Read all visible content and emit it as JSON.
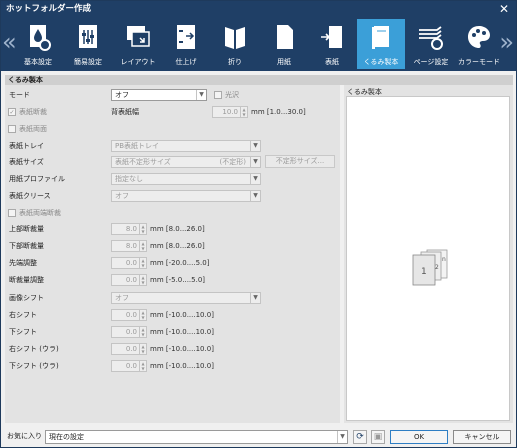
{
  "window": {
    "title": "ホットフォルダー作成"
  },
  "toolbar": {
    "tabs": [
      {
        "label": "基本設定",
        "icon": "drop-gear-icon"
      },
      {
        "label": "簡易設定",
        "icon": "sliders-doc-icon"
      },
      {
        "label": "レイアウト",
        "icon": "layout-icon"
      },
      {
        "label": "仕上げ",
        "icon": "staple-doc-icon"
      },
      {
        "label": "折り",
        "icon": "fold-icon"
      },
      {
        "label": "用紙",
        "icon": "paper-icon"
      },
      {
        "label": "表紙",
        "icon": "cover-icon"
      },
      {
        "label": "くるみ製本",
        "icon": "book-icon"
      },
      {
        "label": "ページ設定",
        "icon": "page-gear-icon"
      },
      {
        "label": "カラーモード",
        "icon": "palette-icon"
      }
    ],
    "active": "くるみ製本",
    "active_color": "#3b9fd8",
    "bar_color": "#1f3f66"
  },
  "section": {
    "title": "くるみ製本"
  },
  "form": {
    "mode": {
      "label": "モード",
      "value": "オフ",
      "gloss_label": "光沢"
    },
    "cover_trim": {
      "label": "表紙断裁",
      "checked": true,
      "spine_label": "背表紙幅",
      "spine_value": "10.0",
      "spine_unit": "mm [1.0...30.0]"
    },
    "cover_both_sides": {
      "label": "表紙両面"
    },
    "cover_tray": {
      "label": "表紙トレイ",
      "value": "PB表紙トレイ"
    },
    "cover_size": {
      "label": "表紙サイズ",
      "value": "表紙不定形サイズ",
      "value_note": "(不定形)",
      "button": "不定形サイズ..."
    },
    "paper_profile": {
      "label": "用紙プロファイル",
      "value": "指定なし"
    },
    "cover_crease": {
      "label": "表紙クリース",
      "value": "オフ"
    },
    "cover_both_trim": {
      "label": "表紙両端断裁"
    },
    "top_trim": {
      "label": "上部断裁量",
      "value": "8.0",
      "unit": "mm [8.0...26.0]"
    },
    "bottom_trim": {
      "label": "下部断裁量",
      "value": "8.0",
      "unit": "mm [8.0...26.0]"
    },
    "lead_adjust": {
      "label": "先端調整",
      "value": "0.0",
      "unit": "mm [-20.0....5.0]"
    },
    "trim_adjust": {
      "label": "断裁量調整",
      "value": "0.0",
      "unit": "mm [-5.0....5.0]"
    },
    "image_shift": {
      "label": "画像シフト",
      "value": "オフ"
    },
    "right_shift": {
      "label": "右シフト",
      "value": "0.0",
      "unit": "mm [-10.0....10.0]"
    },
    "down_shift": {
      "label": "下シフト",
      "value": "0.0",
      "unit": "mm [-10.0....10.0]"
    },
    "right_shift_back": {
      "label": "右シフト (ウラ)",
      "value": "0.0",
      "unit": "mm [-10.0....10.0]"
    },
    "down_shift_back": {
      "label": "下シフト (ウラ)",
      "value": "0.0",
      "unit": "mm [-10.0....10.0]"
    }
  },
  "preview": {
    "title": "くるみ製本",
    "pages": [
      "1",
      "2",
      "n"
    ]
  },
  "footer": {
    "favorites_label": "お気に入り",
    "favorites_value": "現在の設定",
    "ok": "OK",
    "cancel": "キャンセル"
  }
}
